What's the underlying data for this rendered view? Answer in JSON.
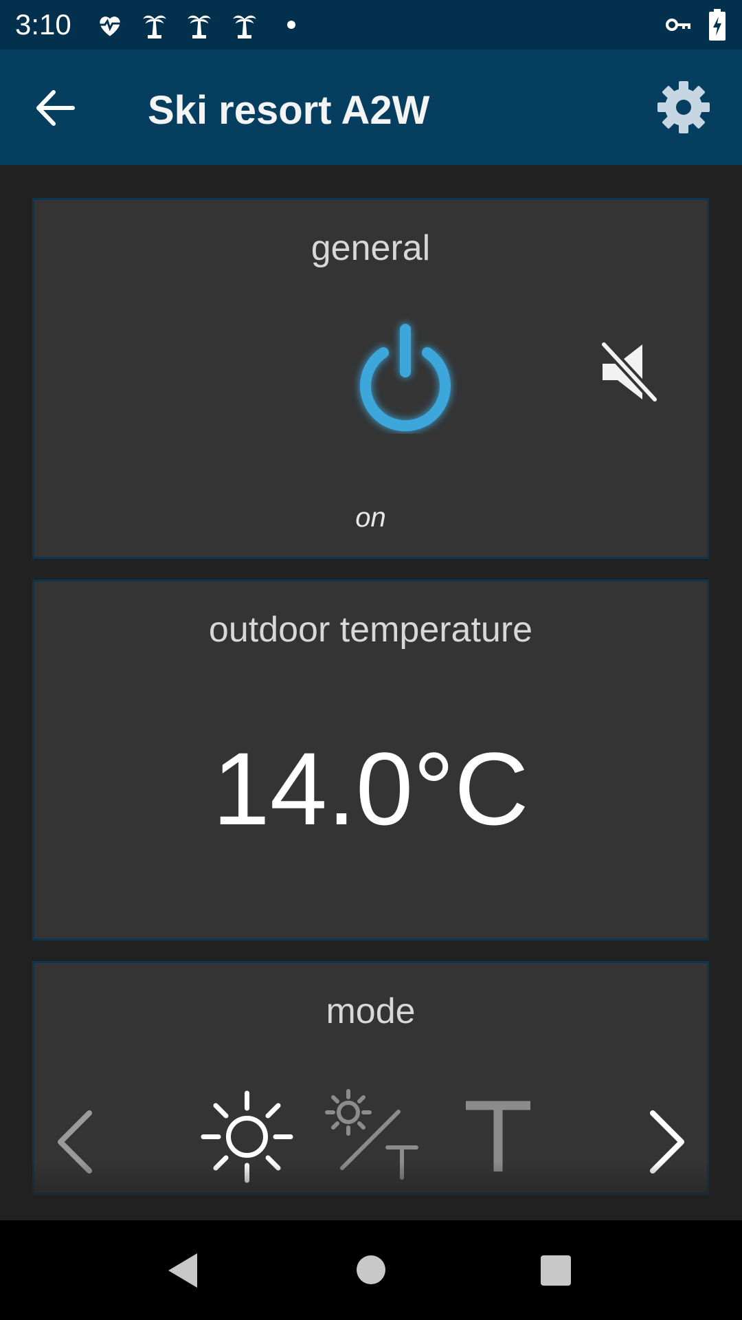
{
  "status_bar": {
    "time": "3:10",
    "notification_icons": [
      "heart-monitor-icon",
      "palm-tree-icon",
      "palm-tree-icon",
      "palm-tree-icon",
      "dot-icon"
    ],
    "right_icons": [
      "vpn-key-icon",
      "battery-charging-icon"
    ]
  },
  "app_bar": {
    "title": "Ski resort A2W",
    "back_icon": "arrow-left-icon",
    "settings_icon": "gear-icon",
    "color": "#053e5f"
  },
  "general": {
    "title": "general",
    "power_icon": "power-icon",
    "mute_icon": "speaker-muted-icon",
    "state": "on",
    "accent": "#3ea7dc"
  },
  "outdoor": {
    "title": "outdoor temperature",
    "value": "14.0°C"
  },
  "mode": {
    "title": "mode",
    "options": [
      "sun-icon",
      "sun-or-thermostat-icon",
      "thermostat-icon"
    ],
    "selected": "sun-icon"
  },
  "nav_bar": {
    "icons": [
      "back-triangle-icon",
      "home-circle-icon",
      "recents-square-icon"
    ]
  }
}
